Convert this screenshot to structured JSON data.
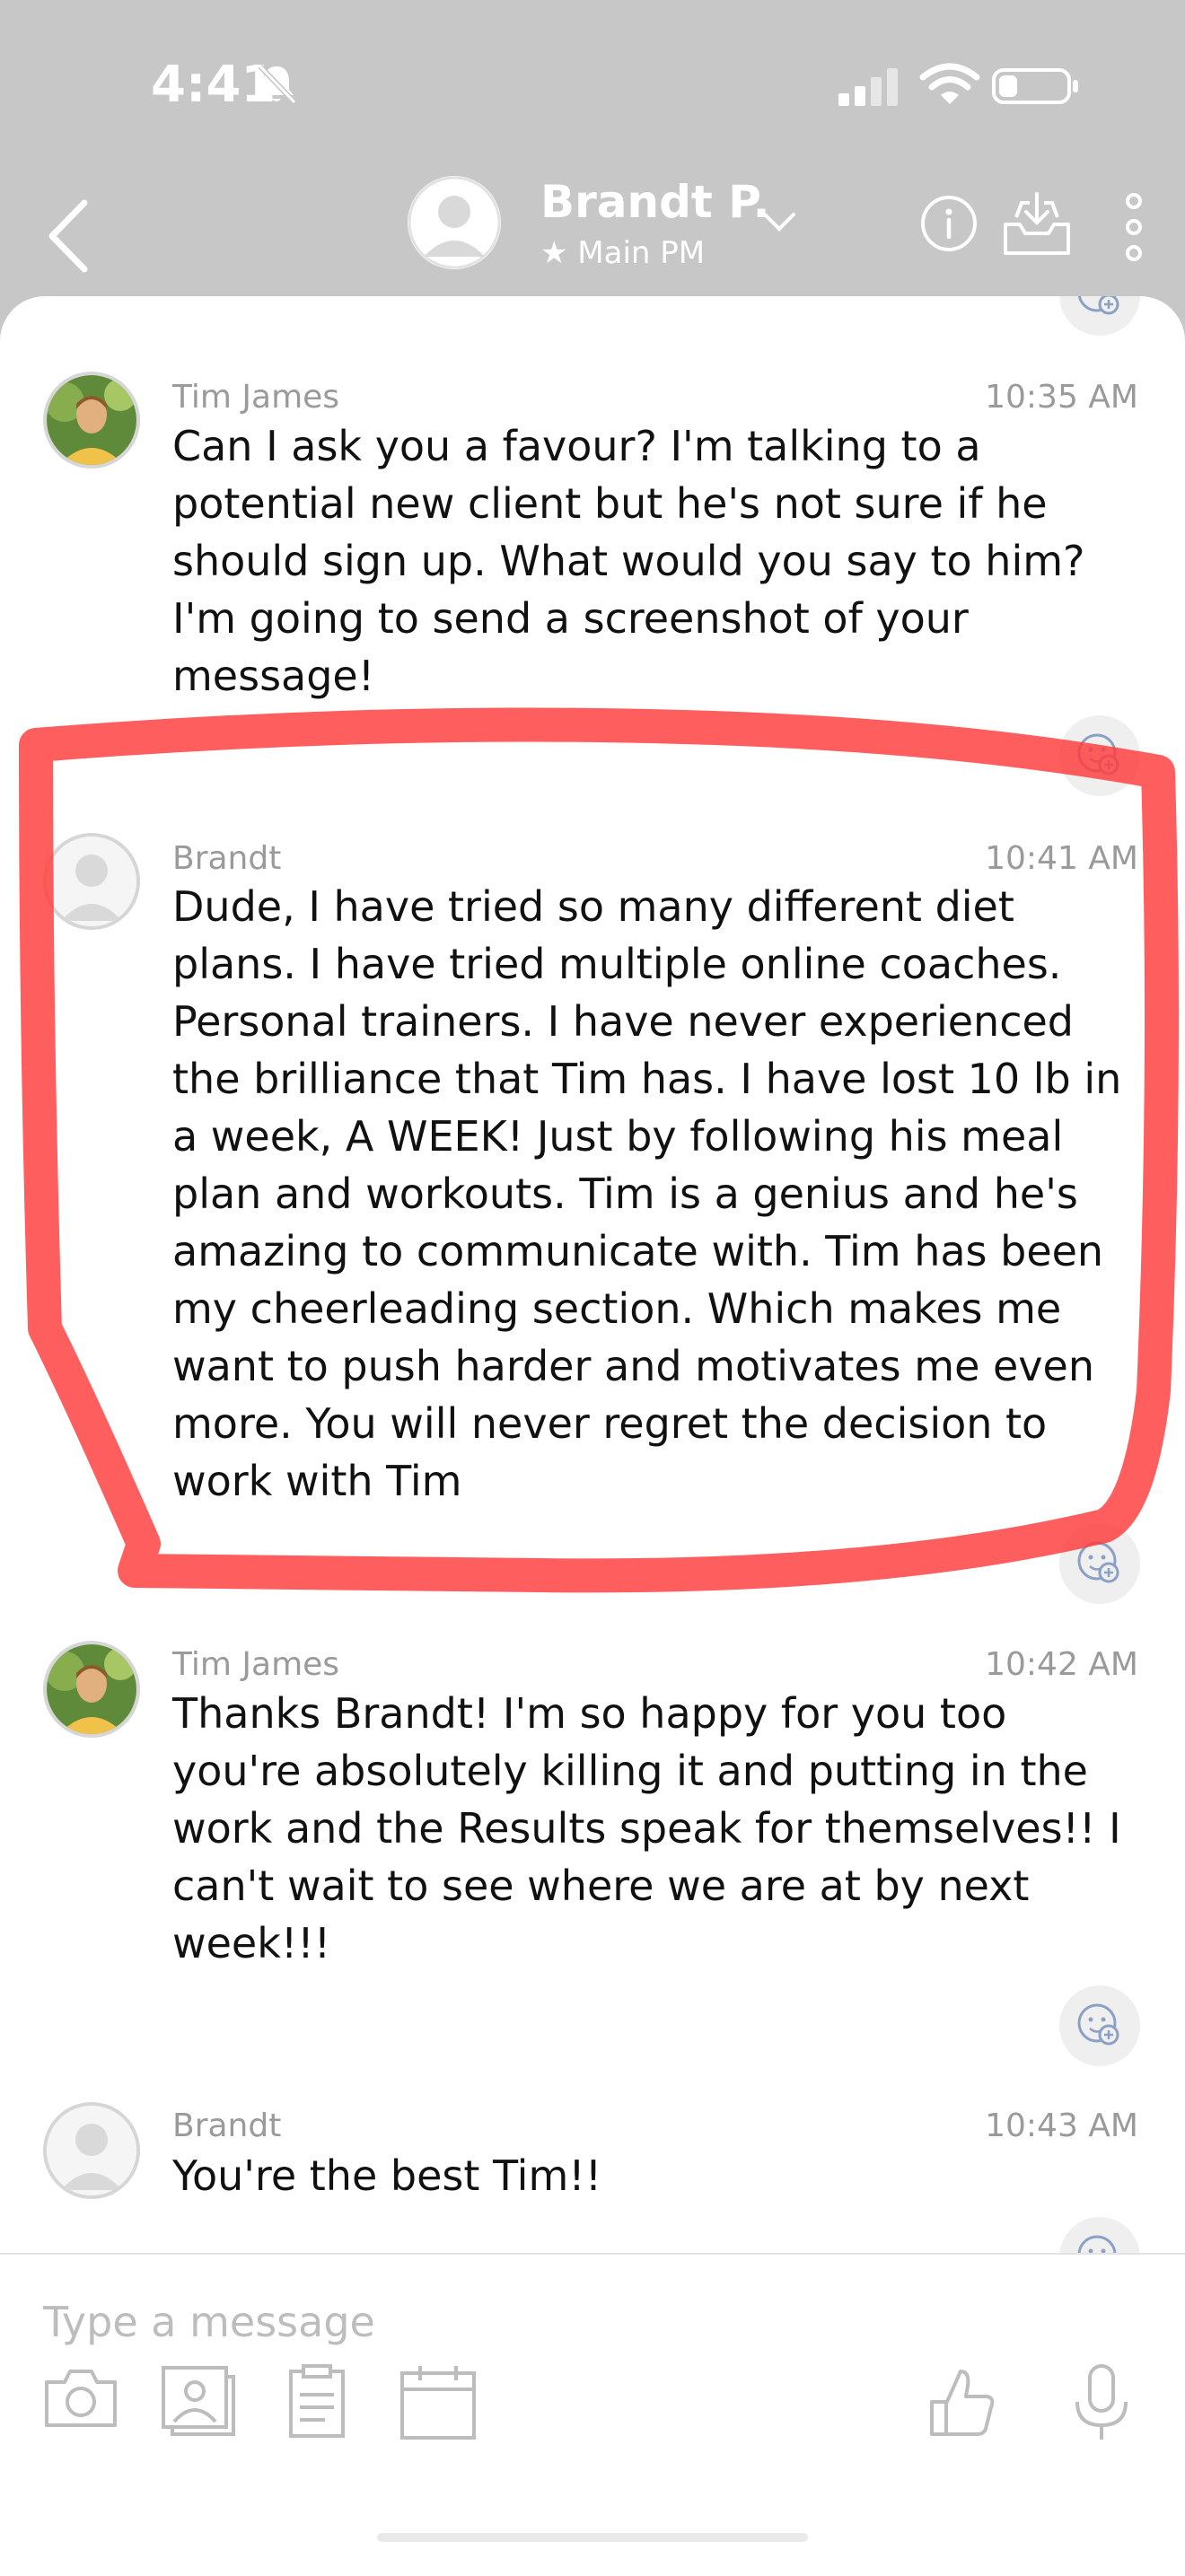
{
  "status_bar": {
    "time": "4:41"
  },
  "header": {
    "contact_name": "Brandt P.",
    "contact_subtitle": "★ Main PM"
  },
  "messages": [
    {
      "sender": "Tim James",
      "time": "10:35 AM",
      "text": "Can I ask you a favour? I'm talking to a\npotential new client but he's not sure if he\nshould sign up. What would you say to him?\nI'm going to send a screenshot of your\nmessage!"
    },
    {
      "sender": "Brandt",
      "time": "10:41 AM",
      "text": "Dude, I have tried so many different diet\nplans. I have tried multiple online coaches.\nPersonal trainers. I have never experienced\nthe brilliance that Tim has. I have lost 10 lb in\na week, A WEEK! Just by following his meal\nplan and workouts. Tim is a genius and he's\namazing to communicate with. Tim has been\nmy cheerleading section. Which makes me\nwant to push harder and motivates me even\nmore. You will never regret the decision to\nwork with Tim"
    },
    {
      "sender": "Tim James",
      "time": "10:42 AM",
      "text": "Thanks Brandt! I'm so happy for you too\nyou're absolutely killing it and putting in the\nwork and the Results speak for themselves!! I\ncan't wait to see where we are at by next\nweek!!!"
    },
    {
      "sender": "Brandt",
      "time": "10:43 AM",
      "text": "You're the best Tim!!"
    }
  ],
  "composer": {
    "placeholder": "Type a message"
  },
  "colors": {
    "header_bg": "#c7c7c7",
    "highlight": "#ff3b3b",
    "meta_text": "#9a9a9a"
  }
}
